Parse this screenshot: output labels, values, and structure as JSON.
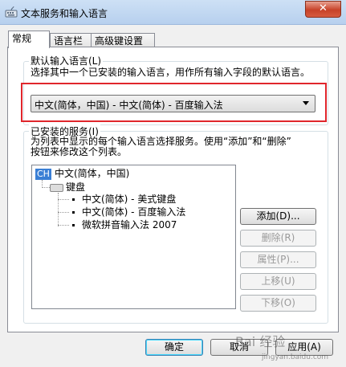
{
  "window": {
    "title": "文本服务和输入语言",
    "close_label": "✕"
  },
  "tabs": [
    {
      "label": "常规",
      "active": true
    },
    {
      "label": "语言栏",
      "active": false
    },
    {
      "label": "高级键设置",
      "active": false
    }
  ],
  "default_language": {
    "group_title": "默认输入语言(L)",
    "description": "选择其中一个已安装的输入语言，用作所有输入字段的默认语言。",
    "selected": "中文(简体，中国) - 中文(简体) - 百度输入法"
  },
  "installed_services": {
    "group_title": "已安装的服务(I)",
    "description_line1": "为列表中显示的每个输入语言选择服务。使用“添加”和“删除”",
    "description_line2": "按钮来修改这个列表。",
    "tree": {
      "language_badge": "CH",
      "language_label": "中文(简体，中国)",
      "category_label": "键盘",
      "items": [
        "中文(简体) - 美式键盘",
        "中文(简体) - 百度输入法",
        "微软拼音输入法 2007"
      ]
    },
    "buttons": {
      "add": "添加(D)...",
      "remove": "删除(R)",
      "properties": "属性(P)...",
      "move_up": "上移(U)",
      "move_down": "下移(O)"
    }
  },
  "footer": {
    "ok": "确定",
    "cancel": "取消",
    "apply": "应用(A)"
  },
  "watermark": {
    "text": "Bai 经验",
    "url": "jingyan.baidu.com"
  },
  "colors": {
    "highlight_border": "#e0262c",
    "badge_bg": "#3a7fd5"
  }
}
